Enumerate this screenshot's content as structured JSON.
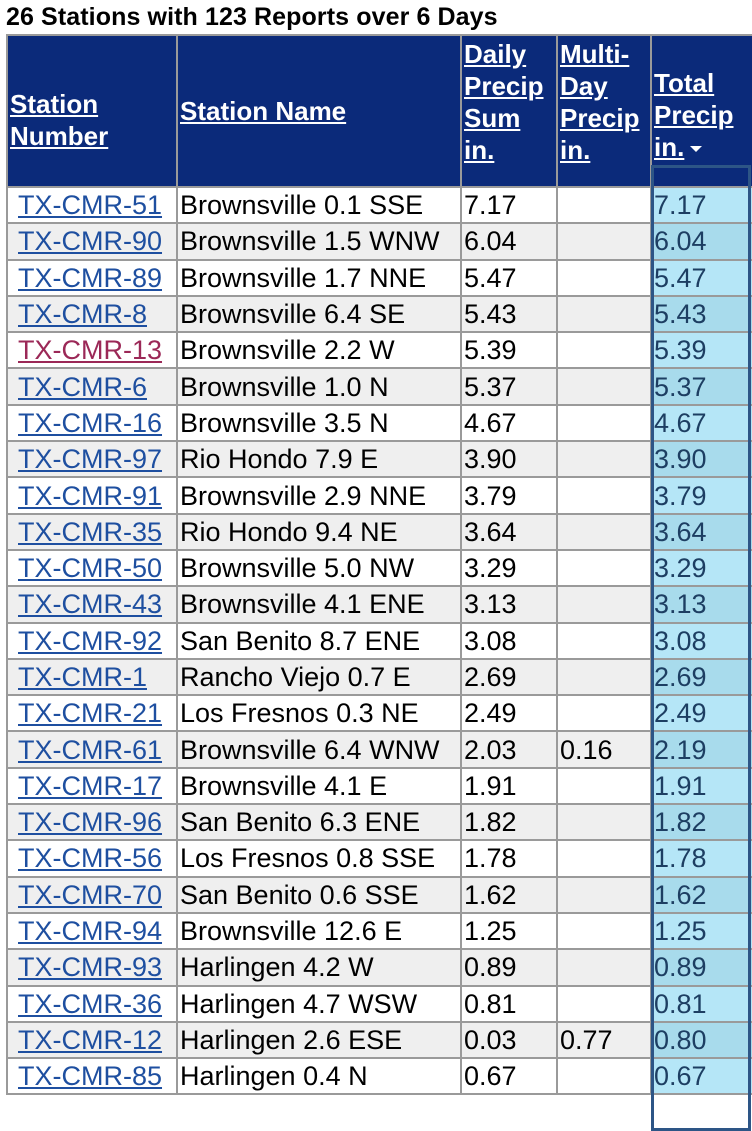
{
  "title": "26 Stations with 123 Reports over 6 Days",
  "colors": {
    "header_bg": "#0b2a7a",
    "link": "#1e4fa0",
    "visited_link": "#9b2857",
    "highlight_col": "#b5e6f7",
    "highlight_border": "#2d5586"
  },
  "columns": [
    {
      "label": "Station Number",
      "sortable": true
    },
    {
      "label": "Station Name",
      "sortable": true
    },
    {
      "label": "Daily Precip Sum in.",
      "sortable": true
    },
    {
      "label": "Multi-Day Precip in.",
      "sortable": true
    },
    {
      "label": "Total Precip in.",
      "sortable": true,
      "sorted": "descending",
      "icon": "sort-down-icon"
    }
  ],
  "rows": [
    {
      "station_number": "TX-CMR-51",
      "station_name": "Brownsville 0.1 SSE",
      "daily": "7.17",
      "multi": "",
      "total": "7.17"
    },
    {
      "station_number": "TX-CMR-90",
      "station_name": "Brownsville 1.5 WNW",
      "daily": "6.04",
      "multi": "",
      "total": "6.04"
    },
    {
      "station_number": "TX-CMR-89",
      "station_name": "Brownsville 1.7 NNE",
      "daily": "5.47",
      "multi": "",
      "total": "5.47"
    },
    {
      "station_number": "TX-CMR-8",
      "station_name": "Brownsville 6.4 SE",
      "daily": "5.43",
      "multi": "",
      "total": "5.43"
    },
    {
      "station_number": "TX-CMR-13",
      "station_name": "Brownsville 2.2 W",
      "daily": "5.39",
      "multi": "",
      "total": "5.39",
      "visited": true
    },
    {
      "station_number": "TX-CMR-6",
      "station_name": "Brownsville 1.0 N",
      "daily": "5.37",
      "multi": "",
      "total": "5.37"
    },
    {
      "station_number": "TX-CMR-16",
      "station_name": "Brownsville 3.5 N",
      "daily": "4.67",
      "multi": "",
      "total": "4.67"
    },
    {
      "station_number": "TX-CMR-97",
      "station_name": "Rio Hondo 7.9 E",
      "daily": "3.90",
      "multi": "",
      "total": "3.90"
    },
    {
      "station_number": "TX-CMR-91",
      "station_name": "Brownsville 2.9 NNE",
      "daily": "3.79",
      "multi": "",
      "total": "3.79"
    },
    {
      "station_number": "TX-CMR-35",
      "station_name": "Rio Hondo 9.4 NE",
      "daily": "3.64",
      "multi": "",
      "total": "3.64"
    },
    {
      "station_number": "TX-CMR-50",
      "station_name": "Brownsville 5.0 NW",
      "daily": "3.29",
      "multi": "",
      "total": "3.29"
    },
    {
      "station_number": "TX-CMR-43",
      "station_name": "Brownsville 4.1 ENE",
      "daily": "3.13",
      "multi": "",
      "total": "3.13"
    },
    {
      "station_number": "TX-CMR-92",
      "station_name": "San Benito 8.7 ENE",
      "daily": "3.08",
      "multi": "",
      "total": "3.08"
    },
    {
      "station_number": "TX-CMR-1",
      "station_name": "Rancho Viejo 0.7 E",
      "daily": "2.69",
      "multi": "",
      "total": "2.69"
    },
    {
      "station_number": "TX-CMR-21",
      "station_name": "Los Fresnos 0.3 NE",
      "daily": "2.49",
      "multi": "",
      "total": "2.49"
    },
    {
      "station_number": "TX-CMR-61",
      "station_name": "Brownsville 6.4 WNW",
      "daily": "2.03",
      "multi": "0.16",
      "total": "2.19"
    },
    {
      "station_number": "TX-CMR-17",
      "station_name": "Brownsville 4.1 E",
      "daily": "1.91",
      "multi": "",
      "total": "1.91"
    },
    {
      "station_number": "TX-CMR-96",
      "station_name": "San Benito 6.3 ENE",
      "daily": "1.82",
      "multi": "",
      "total": "1.82"
    },
    {
      "station_number": "TX-CMR-56",
      "station_name": "Los Fresnos 0.8 SSE",
      "daily": "1.78",
      "multi": "",
      "total": "1.78"
    },
    {
      "station_number": "TX-CMR-70",
      "station_name": "San Benito 0.6 SSE",
      "daily": "1.62",
      "multi": "",
      "total": "1.62"
    },
    {
      "station_number": "TX-CMR-94",
      "station_name": "Brownsville 12.6 E",
      "daily": "1.25",
      "multi": "",
      "total": "1.25"
    },
    {
      "station_number": "TX-CMR-93",
      "station_name": "Harlingen 4.2 W",
      "daily": "0.89",
      "multi": "",
      "total": "0.89"
    },
    {
      "station_number": "TX-CMR-36",
      "station_name": "Harlingen 4.7 WSW",
      "daily": "0.81",
      "multi": "",
      "total": "0.81"
    },
    {
      "station_number": "TX-CMR-12",
      "station_name": "Harlingen 2.6 ESE",
      "daily": "0.03",
      "multi": "0.77",
      "total": "0.80"
    },
    {
      "station_number": "TX-CMR-85",
      "station_name": "Harlingen 0.4 N",
      "daily": "0.67",
      "multi": "",
      "total": "0.67"
    }
  ]
}
